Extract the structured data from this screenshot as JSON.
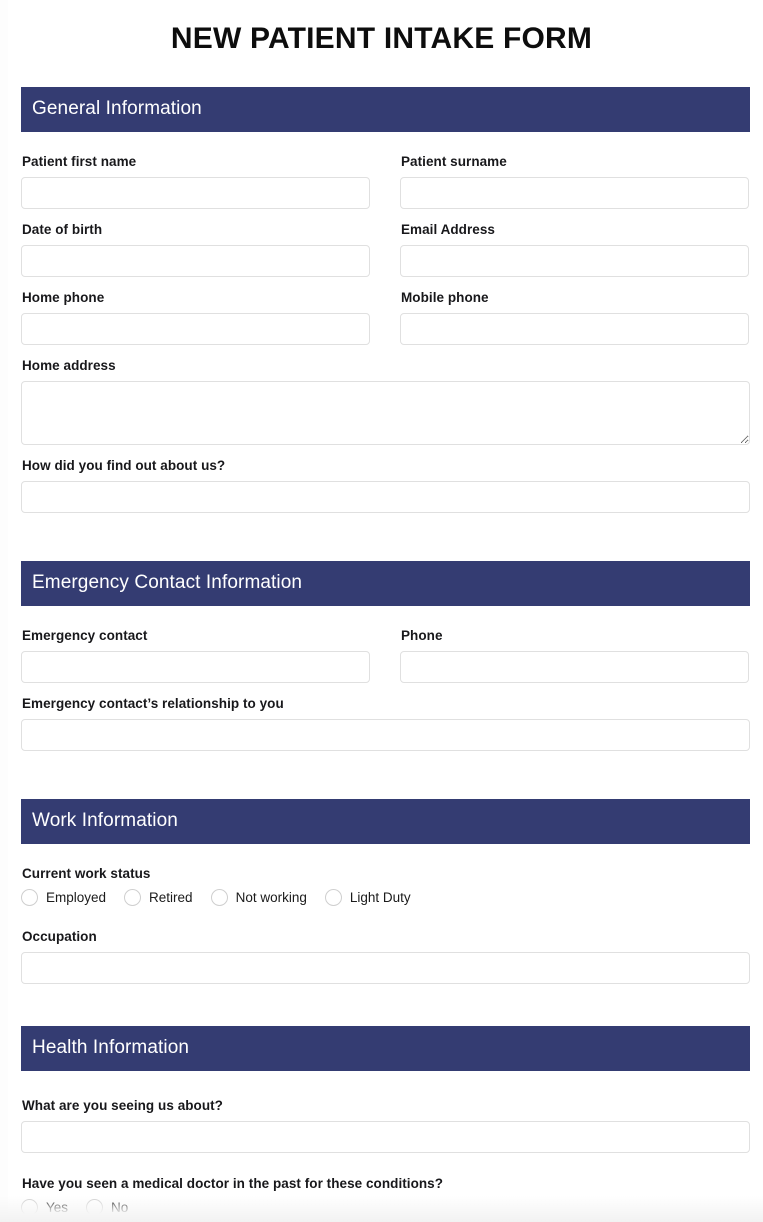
{
  "form": {
    "title": "NEW PATIENT INTAKE FORM",
    "accent_color": "#343c72",
    "field_border_color": "#e0e0e0",
    "radio_border_color": "#cfcfcf",
    "background_color": "#ffffff"
  },
  "sections": {
    "general": {
      "heading": "General Information",
      "fields": {
        "first_name": {
          "label": "Patient first name",
          "value": "",
          "placeholder": ""
        },
        "surname": {
          "label": "Patient surname",
          "value": "",
          "placeholder": ""
        },
        "dob": {
          "label": "Date of birth",
          "value": "",
          "placeholder": ""
        },
        "email": {
          "label": "Email Address",
          "value": "",
          "placeholder": ""
        },
        "home_phone": {
          "label": "Home phone",
          "value": "",
          "placeholder": ""
        },
        "mobile_phone": {
          "label": "Mobile phone",
          "value": "",
          "placeholder": ""
        },
        "home_address": {
          "label": "Home address",
          "value": "",
          "placeholder": ""
        },
        "referral": {
          "label": "How did you find out about us?",
          "value": "",
          "placeholder": ""
        }
      }
    },
    "emergency": {
      "heading": "Emergency Contact Information",
      "fields": {
        "contact_name": {
          "label": "Emergency contact",
          "value": "",
          "placeholder": ""
        },
        "contact_phone": {
          "label": "Phone",
          "value": "",
          "placeholder": ""
        },
        "relationship": {
          "label": "Emergency contact’s relationship to you",
          "value": "",
          "placeholder": ""
        }
      }
    },
    "work": {
      "heading": "Work Information",
      "fields": {
        "work_status": {
          "label": "Current work status",
          "options": [
            "Employed",
            "Retired",
            "Not working",
            "Light Duty"
          ],
          "selected": ""
        },
        "occupation": {
          "label": "Occupation",
          "value": "",
          "placeholder": ""
        }
      }
    },
    "health": {
      "heading": "Health Information",
      "fields": {
        "reason": {
          "label": "What are you seeing us about?",
          "value": "",
          "placeholder": ""
        },
        "seen_doctor": {
          "label": "Have you seen a medical doctor in the past for these conditions?",
          "options": [
            "Yes",
            "No"
          ],
          "selected": ""
        }
      }
    }
  }
}
